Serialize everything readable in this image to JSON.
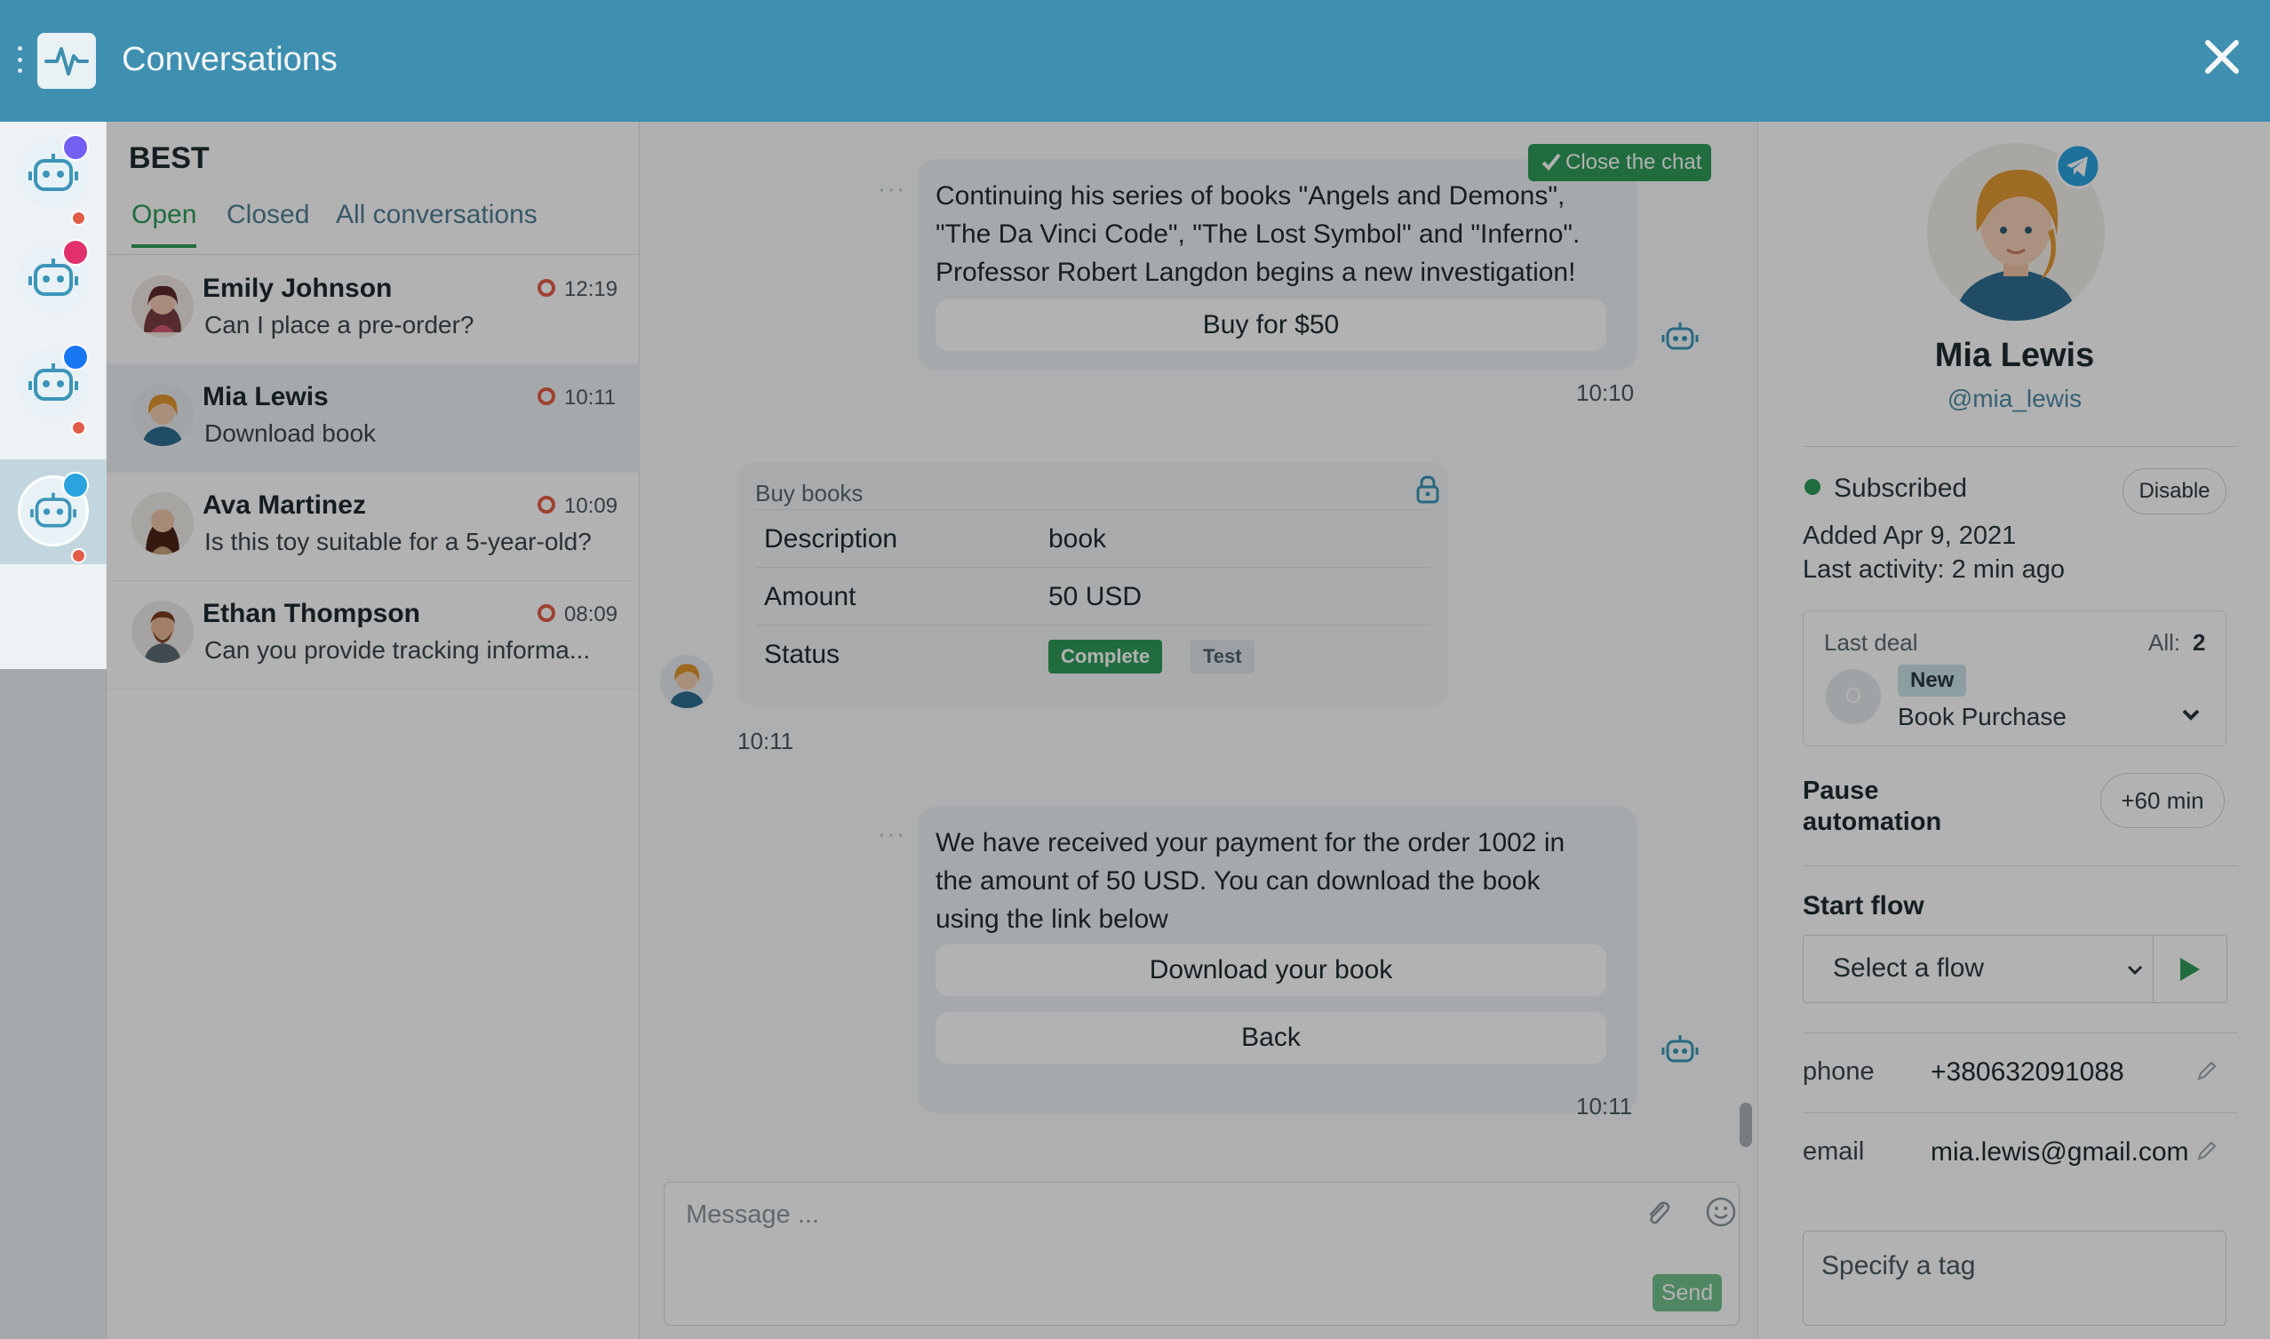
{
  "header": {
    "title": "Conversations"
  },
  "rail": {
    "channels": [
      {
        "name": "viber",
        "badge_color": "#7360f2",
        "unread": true,
        "active": false
      },
      {
        "name": "instagram",
        "badge_color": "#e1306c",
        "unread": false,
        "active": false
      },
      {
        "name": "messenger",
        "badge_color": "#1877f2",
        "unread": true,
        "active": false
      },
      {
        "name": "telegram",
        "badge_color": "#2aa3df",
        "unread": true,
        "active": true
      }
    ]
  },
  "list": {
    "group": "BEST",
    "tabs": [
      "Open",
      "Closed",
      "All conversations"
    ],
    "conversations": [
      {
        "name": "Emily Johnson",
        "preview": "Can I place a pre-order?",
        "time": "12:19"
      },
      {
        "name": "Mia Lewis",
        "preview": "Download book",
        "time": "10:11"
      },
      {
        "name": "Ava Martinez",
        "preview": "Is this toy suitable for a 5-year-old?",
        "time": "10:09"
      },
      {
        "name": "Ethan Thompson",
        "preview": "Can you provide tracking informa...",
        "time": "08:09"
      }
    ]
  },
  "chat": {
    "close_label": "Close the chat",
    "msg1": {
      "lines": [
        "Continuing his series of books \"Angels and Demons\",",
        "\"The Da Vinci Code\", \"The Lost Symbol\" and \"Inferno\".",
        "Professor Robert Langdon begins a new investigation!"
      ],
      "button": "Buy for $50",
      "time": "10:10"
    },
    "card": {
      "caption": "Buy books",
      "rows": [
        {
          "key": "Description",
          "value": "book"
        },
        {
          "key": "Amount",
          "value": "50 USD"
        },
        {
          "key": "Status",
          "value": ""
        }
      ],
      "status_complete": "Complete",
      "status_test": "Test",
      "time": "10:11"
    },
    "msg2": {
      "lines": [
        "We have received your payment for the order 1002 in",
        "the amount of 50 USD. You can download the book",
        "using the link below"
      ],
      "buttons": [
        "Download your book",
        "Back"
      ],
      "time": "10:11"
    },
    "composer": {
      "placeholder": "Message ...",
      "send": "Send"
    }
  },
  "profile": {
    "name": "Mia Lewis",
    "handle": "@mia_lewis",
    "subscribed": "Subscribed",
    "disable": "Disable",
    "added": "Added Apr 9, 2021",
    "last_activity": "Last activity: 2 min ago",
    "deal": {
      "label": "Last deal",
      "all_label": "All:",
      "all_count": "2",
      "avatar_letter": "O",
      "tag": "New",
      "title": "Book Purchase"
    },
    "pause_line1": "Pause",
    "pause_line2": "automation",
    "pause_button": "+60 min",
    "start_flow": "Start flow",
    "flow_placeholder": "Select a flow",
    "phone_label": "phone",
    "phone_value": "+380632091088",
    "email_label": "email",
    "email_value": "mia.lewis@gmail.com",
    "tag_placeholder": "Specify a tag"
  },
  "colors": {
    "header": "#3f8fb0",
    "accent_green": "#2e9b59",
    "unread_red": "#e25d48"
  }
}
